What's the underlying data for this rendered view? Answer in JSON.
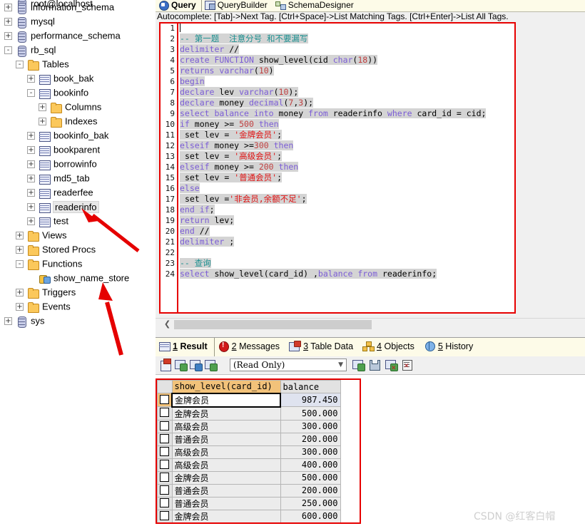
{
  "tree": {
    "root_label": "root@localhost",
    "items": [
      {
        "label": "root@localhost",
        "icon": "db-icon",
        "indent": 0,
        "expander": "none",
        "selected": false
      },
      {
        "label": "information_schema",
        "icon": "db-icon",
        "indent": 0,
        "expander": "+",
        "selected": false
      },
      {
        "label": "mysql",
        "icon": "db-icon",
        "indent": 0,
        "expander": "+",
        "selected": false
      },
      {
        "label": "performance_schema",
        "icon": "db-icon",
        "indent": 0,
        "expander": "+",
        "selected": false
      },
      {
        "label": "rb_sql",
        "icon": "db-icon",
        "indent": 0,
        "expander": "-",
        "selected": false
      },
      {
        "label": "Tables",
        "icon": "folder-icon",
        "indent": 1,
        "expander": "-",
        "selected": false
      },
      {
        "label": "book_bak",
        "icon": "table-icon",
        "indent": 2,
        "expander": "+",
        "selected": false
      },
      {
        "label": "bookinfo",
        "icon": "table-icon",
        "indent": 2,
        "expander": "-",
        "selected": false
      },
      {
        "label": "Columns",
        "icon": "folder-icon",
        "indent": 3,
        "expander": "+",
        "selected": false
      },
      {
        "label": "Indexes",
        "icon": "folder-icon",
        "indent": 3,
        "expander": "+",
        "selected": false
      },
      {
        "label": "bookinfo_bak",
        "icon": "table-icon",
        "indent": 2,
        "expander": "+",
        "selected": false
      },
      {
        "label": "bookparent",
        "icon": "table-icon",
        "indent": 2,
        "expander": "+",
        "selected": false
      },
      {
        "label": "borrowinfo",
        "icon": "table-icon",
        "indent": 2,
        "expander": "+",
        "selected": false
      },
      {
        "label": "md5_tab",
        "icon": "table-icon",
        "indent": 2,
        "expander": "+",
        "selected": false
      },
      {
        "label": "readerfee",
        "icon": "table-icon",
        "indent": 2,
        "expander": "+",
        "selected": false
      },
      {
        "label": "readerinfo",
        "icon": "table-icon",
        "indent": 2,
        "expander": "+",
        "selected": true
      },
      {
        "label": "test",
        "icon": "table-icon",
        "indent": 2,
        "expander": "+",
        "selected": false
      },
      {
        "label": "Views",
        "icon": "folder-icon",
        "indent": 1,
        "expander": "+",
        "selected": false
      },
      {
        "label": "Stored Procs",
        "icon": "folder-icon",
        "indent": 1,
        "expander": "+",
        "selected": false
      },
      {
        "label": "Functions",
        "icon": "folder-icon",
        "indent": 1,
        "expander": "-",
        "selected": false
      },
      {
        "label": "show_name_store",
        "icon": "function-icon",
        "indent": 2,
        "expander": "none",
        "selected": false
      },
      {
        "label": "Triggers",
        "icon": "folder-icon",
        "indent": 1,
        "expander": "+",
        "selected": false
      },
      {
        "label": "Events",
        "icon": "folder-icon",
        "indent": 1,
        "expander": "+",
        "selected": false
      },
      {
        "label": "sys",
        "icon": "db-icon",
        "indent": 0,
        "expander": "+",
        "selected": false
      }
    ]
  },
  "query_tabs": [
    {
      "label": "Query",
      "icon": "query-icon",
      "active": true
    },
    {
      "label": "QueryBuilder",
      "icon": "query-builder-icon",
      "active": false
    },
    {
      "label": "SchemaDesigner",
      "icon": "schema-designer-icon",
      "active": false
    }
  ],
  "hint_bar": "Autocomplete: [Tab]->Next Tag. [Ctrl+Space]->List Matching Tags. [Ctrl+Enter]->List All Tags.",
  "editor": {
    "line_numbers": [
      "1",
      "2",
      "3",
      "4",
      "5",
      "6",
      "7",
      "8",
      "9",
      "10",
      "11",
      "12",
      "13",
      "14",
      "15",
      "16",
      "17",
      "18",
      "19",
      "20",
      "21",
      "22",
      "23",
      "24"
    ],
    "lines": [
      "",
      "-- 第一题  注意分号 和不要漏写",
      "delimiter //",
      "create FUNCTION show_level(cid char(18))",
      "returns varchar(10)",
      "begin",
      "declare lev varchar(10);",
      "declare money decimal(7,3);",
      "select balance into money from readerinfo where card_id = cid;",
      "if money >= 500 then",
      " set lev = '金牌会员';",
      "elseif money >=300 then",
      " set lev = '高级会员';",
      "elseif money >= 200 then",
      " set lev = '普通会员';",
      "else",
      " set lev ='非会员,余额不足';",
      "end if;",
      "return lev;",
      "end //",
      "delimiter ;",
      "",
      "-- 查询",
      "select show_level(card_id) ,balance from readerinfo;"
    ]
  },
  "result_tabs": [
    {
      "num": "1",
      "label": "Result",
      "icon": "result-grid-icon",
      "active": true
    },
    {
      "num": "2",
      "label": "Messages",
      "icon": "messages-icon",
      "active": false
    },
    {
      "num": "3",
      "label": "Table Data",
      "icon": "table-data-icon",
      "active": false
    },
    {
      "num": "4",
      "label": "Objects",
      "icon": "objects-icon",
      "active": false
    },
    {
      "num": "5",
      "label": "History",
      "icon": "history-icon",
      "active": false
    }
  ],
  "grid_toolbar": {
    "mode_value": "(Read Only)",
    "buttons": [
      "new-record-icon",
      "add-row-icon",
      "duplicate-row-icon",
      "copy-row-icon",
      "insert-record-icon",
      "save-record-icon",
      "delete-record-icon",
      "edit-record-icon"
    ]
  },
  "result_grid": {
    "columns": [
      "show_level(card_id)",
      "balance"
    ],
    "selected_column": "show_level(card_id)",
    "rows": [
      {
        "level": "金牌会员",
        "balance": "987.450",
        "current": true
      },
      {
        "level": "金牌会员",
        "balance": "500.000",
        "current": false
      },
      {
        "level": "高级会员",
        "balance": "300.000",
        "current": false
      },
      {
        "level": "普通会员",
        "balance": "200.000",
        "current": false
      },
      {
        "level": "高级会员",
        "balance": "300.000",
        "current": false
      },
      {
        "level": "高级会员",
        "balance": "400.000",
        "current": false
      },
      {
        "level": "金牌会员",
        "balance": "500.000",
        "current": false
      },
      {
        "level": "普通会员",
        "balance": "200.000",
        "current": false
      },
      {
        "level": "普通会员",
        "balance": "250.000",
        "current": false
      },
      {
        "level": "金牌会员",
        "balance": "600.000",
        "current": false
      }
    ]
  },
  "watermark": "CSDN @红客白帽",
  "annotation": {
    "box_color": "#e60000",
    "arrow_color": "#e50000",
    "arrow_targets": [
      "readerinfo",
      "show_name_store"
    ]
  }
}
